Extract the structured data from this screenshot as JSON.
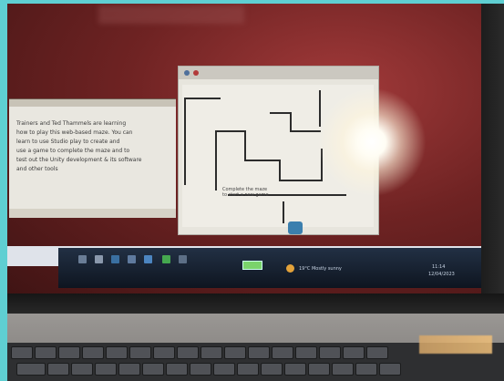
{
  "left_panel": {
    "lines": [
      "Trainers and Ted Thammels are learning",
      "how to play this web-based maze. You can",
      "learn to use Studio play to create and",
      "use a game to complete the maze and to",
      "test out the Unity development & its software",
      "and other tools"
    ]
  },
  "maze_window": {
    "label_line1": "Complete the maze",
    "label_line2": "to start a new game"
  },
  "taskbar": {
    "weather_text": "19°C  Mostly sunny",
    "time": "11:14",
    "date": "12/04/2023"
  },
  "colors": {
    "wall": "#2c2c2c",
    "glare": "#ffffff",
    "screen_bg": "#6f2323"
  }
}
